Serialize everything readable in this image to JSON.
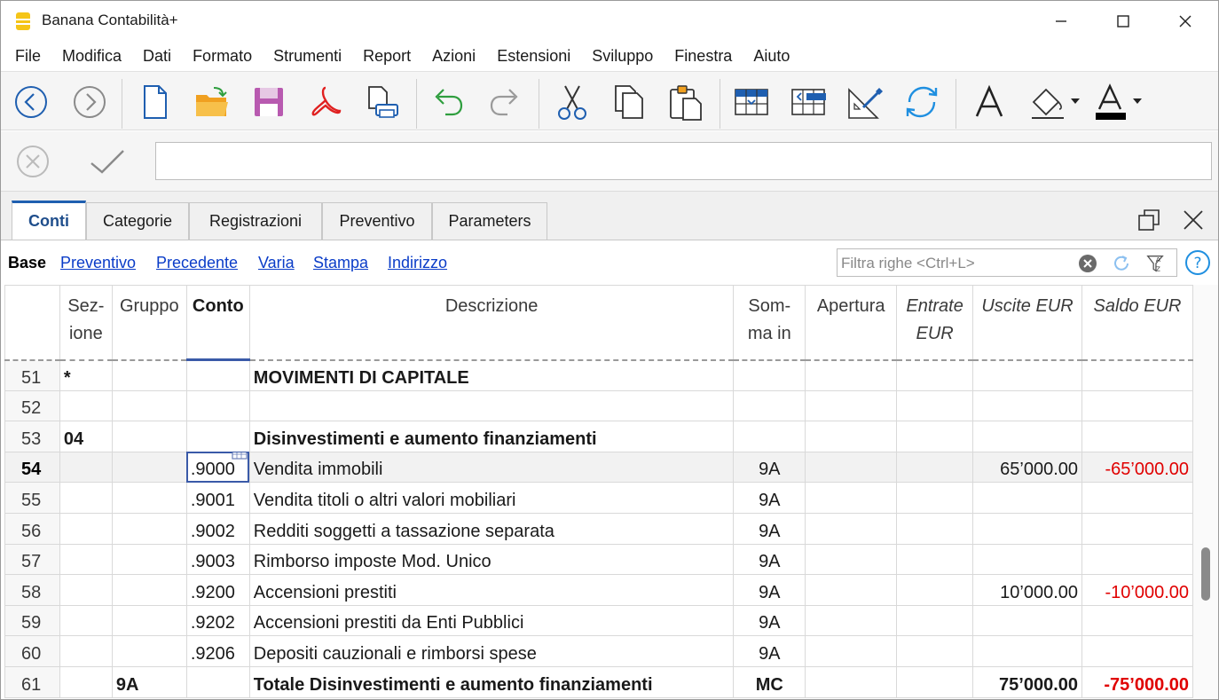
{
  "window": {
    "title": "Banana Contabilità+"
  },
  "menu": [
    "File",
    "Modifica",
    "Dati",
    "Formato",
    "Strumenti",
    "Report",
    "Azioni",
    "Estensioni",
    "Sviluppo",
    "Finestra",
    "Aiuto"
  ],
  "formula_bar": {
    "value": ""
  },
  "tabs": [
    {
      "label": "Conti",
      "active": true
    },
    {
      "label": "Categorie",
      "active": false
    },
    {
      "label": "Registrazioni",
      "active": false
    },
    {
      "label": "Preventivo",
      "active": false
    },
    {
      "label": "Parameters",
      "active": false
    }
  ],
  "views": [
    "Base",
    "Preventivo",
    "Precedente",
    "Varia",
    "Stampa",
    "Indirizzo"
  ],
  "filter": {
    "placeholder": "Filtra righe <Ctrl+L>"
  },
  "table": {
    "headers": {
      "sezione": "Sez-\nione",
      "gruppo": "Gruppo",
      "conto": "Conto",
      "descrizione": "Descrizione",
      "sommain": "Som-\nma in",
      "apertura": "Apertura",
      "entrate": "Entrate\nEUR",
      "uscite": "Uscite EUR",
      "saldo": "Saldo EUR"
    },
    "rows": [
      {
        "n": "51",
        "sez": "*",
        "gruppo": "",
        "conto": "",
        "desc": "MOVIMENTI DI CAPITALE",
        "somma": "",
        "apertura": "",
        "entrate": "",
        "uscite": "",
        "saldo": "",
        "bold": true
      },
      {
        "n": "52",
        "sez": "",
        "gruppo": "",
        "conto": "",
        "desc": "",
        "somma": "",
        "apertura": "",
        "entrate": "",
        "uscite": "",
        "saldo": ""
      },
      {
        "n": "53",
        "sez": "04",
        "gruppo": "",
        "conto": "",
        "desc": "Disinvestimenti e aumento finanziamenti",
        "somma": "",
        "apertura": "",
        "entrate": "",
        "uscite": "",
        "saldo": "",
        "bold": true
      },
      {
        "n": "54",
        "sez": "",
        "gruppo": "",
        "conto": ".9000",
        "desc": "Vendita immobili",
        "somma": "9A",
        "apertura": "",
        "entrate": "",
        "uscite": "65’000.00",
        "saldo": "-65’000.00",
        "selected": true
      },
      {
        "n": "55",
        "sez": "",
        "gruppo": "",
        "conto": ".9001",
        "desc": "Vendita titoli o altri valori mobiliari",
        "somma": "9A",
        "apertura": "",
        "entrate": "",
        "uscite": "",
        "saldo": ""
      },
      {
        "n": "56",
        "sez": "",
        "gruppo": "",
        "conto": ".9002",
        "desc": "Redditi soggetti a tassazione separata",
        "somma": "9A",
        "apertura": "",
        "entrate": "",
        "uscite": "",
        "saldo": ""
      },
      {
        "n": "57",
        "sez": "",
        "gruppo": "",
        "conto": ".9003",
        "desc": "Rimborso imposte Mod. Unico",
        "somma": "9A",
        "apertura": "",
        "entrate": "",
        "uscite": "",
        "saldo": ""
      },
      {
        "n": "58",
        "sez": "",
        "gruppo": "",
        "conto": ".9200",
        "desc": "Accensioni prestiti",
        "somma": "9A",
        "apertura": "",
        "entrate": "",
        "uscite": "10’000.00",
        "saldo": "-10’000.00"
      },
      {
        "n": "59",
        "sez": "",
        "gruppo": "",
        "conto": ".9202",
        "desc": "Accensioni prestiti da Enti Pubblici",
        "somma": "9A",
        "apertura": "",
        "entrate": "",
        "uscite": "",
        "saldo": ""
      },
      {
        "n": "60",
        "sez": "",
        "gruppo": "",
        "conto": ".9206",
        "desc": "Depositi cauzionali e rimborsi spese",
        "somma": "9A",
        "apertura": "",
        "entrate": "",
        "uscite": "",
        "saldo": ""
      },
      {
        "n": "61",
        "sez": "",
        "gruppo": "9A",
        "conto": "",
        "desc": "Totale Disinvestimenti e aumento finanziamenti",
        "somma": "MC",
        "apertura": "",
        "entrate": "",
        "uscite": "75’000.00",
        "saldo": "-75’000.00",
        "bold": true
      }
    ]
  },
  "colors": {
    "accent": "#1f5fb0",
    "link": "#0a3cc8",
    "negative": "#e00000",
    "app_icon": "#f5c518"
  }
}
